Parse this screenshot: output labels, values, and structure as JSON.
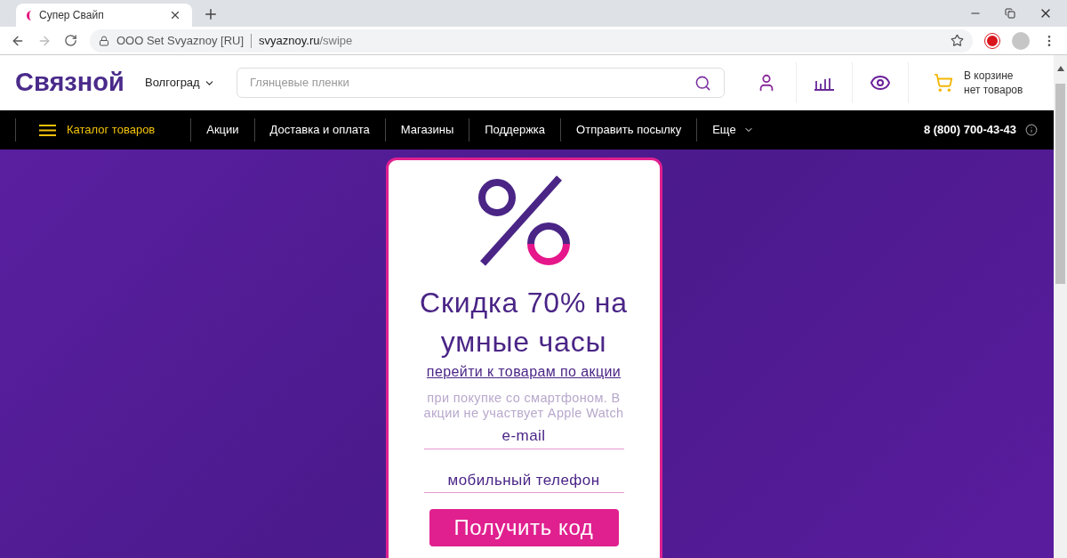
{
  "browser": {
    "tab_title": "Супер Свайп",
    "security_label": "OOO Set Svyaznoy [RU]",
    "url_host": "svyaznoy.ru",
    "url_path": "/swipe"
  },
  "header": {
    "logo": "Связной",
    "city": "Волгоград",
    "search": {
      "placeholder": "Глянцевые пленки"
    },
    "cart": [
      "В корзине",
      "нет товаров"
    ]
  },
  "nav": {
    "catalog": "Каталог товаров",
    "items": [
      {
        "label": "Акции",
        "dropdown": false
      },
      {
        "label": "Доставка и оплата",
        "dropdown": false
      },
      {
        "label": "Магазины",
        "dropdown": false
      },
      {
        "label": "Поддержка",
        "dropdown": false
      },
      {
        "label": "Отправить посылку",
        "dropdown": false
      },
      {
        "label": "Еще",
        "dropdown": true
      }
    ],
    "phone": "8 (800) 700-43-43"
  },
  "promo": {
    "title": "Скидка 70% на умные часы",
    "link": "перейти к товарам по акции",
    "note": "при покупке со смартфоном. В акции не участвует Apple Watch",
    "fields": [
      {
        "placeholder": "e-mail"
      },
      {
        "placeholder": "мобильный телефон"
      }
    ],
    "button": "Получить код"
  }
}
